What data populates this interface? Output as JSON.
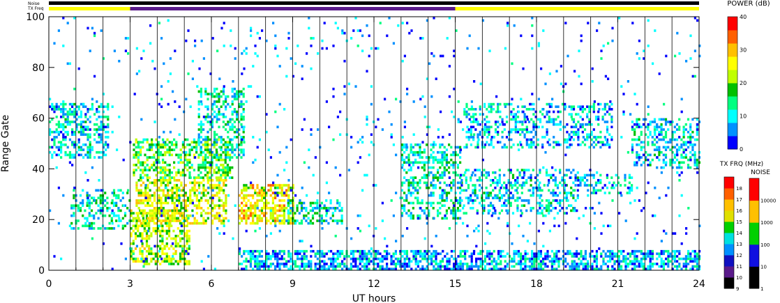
{
  "chart_data": {
    "type": "heatmap",
    "xlabel": "UT hours",
    "ylabel": "Range Gate",
    "xlim": [
      0,
      24
    ],
    "ylim": [
      0,
      100
    ],
    "x_ticks": [
      0,
      3,
      6,
      9,
      12,
      15,
      18,
      21,
      24
    ],
    "y_ticks": [
      0,
      20,
      40,
      60,
      80,
      100
    ],
    "x_tick_labels": [
      "0",
      "3",
      "6",
      "9",
      "12",
      "15",
      "18",
      "21",
      "24"
    ],
    "y_tick_labels": [
      "0",
      "20",
      "40",
      "60",
      "80",
      "100"
    ],
    "scan_boundaries_hours": [
      1,
      2,
      3,
      4,
      5,
      6,
      7,
      8,
      9,
      10,
      11,
      12,
      13,
      14,
      15,
      16,
      17,
      18,
      19,
      20,
      21,
      22,
      23,
      24
    ],
    "top_bars": {
      "noise_label": "Noise",
      "txfreq_label": "TX Freq",
      "noise_color": "#000000",
      "txfreq_segments": [
        {
          "start": 0,
          "end": 3,
          "color": "#ffff00"
        },
        {
          "start": 3,
          "end": 15,
          "color": "#5a1a8a"
        },
        {
          "start": 15,
          "end": 24,
          "color": "#ffff00"
        }
      ]
    },
    "power_colorbar": {
      "title": "POWER (dB)",
      "min": 0,
      "max": 40,
      "tick_labels": [
        "0",
        "10",
        "20",
        "30",
        "40"
      ],
      "colors": [
        "#0000ff",
        "#0090ff",
        "#00ffff",
        "#00ff80",
        "#00c000",
        "#c0ff00",
        "#ffff00",
        "#ffc000",
        "#ff6000",
        "#ff0000"
      ]
    },
    "txfreq_colorbar": {
      "title": "TX FRQ (MHz)",
      "tick_labels": [
        "9",
        "10",
        "11",
        "12",
        "13",
        "14",
        "15",
        "16",
        "17",
        "18"
      ],
      "colors": [
        "#000000",
        "#5a1a8a",
        "#1010c0",
        "#0090ff",
        "#00e0e0",
        "#00d000",
        "#e0e000",
        "#ffc000",
        "#ff6000",
        "#ff0000"
      ]
    },
    "noise_colorbar": {
      "title": "NOISE",
      "tick_labels": [
        "1",
        "10",
        "100",
        "1000",
        "10000"
      ],
      "colors": [
        "#000000",
        "#1010e0",
        "#00d000",
        "#ffc000",
        "#ff0000"
      ]
    },
    "echo_regions": [
      {
        "t0": 0.0,
        "t1": 2.2,
        "g0": 44,
        "g1": 66,
        "density": 0.45,
        "level": 10
      },
      {
        "t0": 0.8,
        "t1": 3.0,
        "g0": 16,
        "g1": 32,
        "density": 0.35,
        "level": 12
      },
      {
        "t0": 3.0,
        "t1": 5.2,
        "g0": 2,
        "g1": 24,
        "density": 0.5,
        "level": 22
      },
      {
        "t0": 3.2,
        "t1": 6.5,
        "g0": 18,
        "g1": 36,
        "density": 0.55,
        "level": 24
      },
      {
        "t0": 3.1,
        "t1": 6.8,
        "g0": 36,
        "g1": 52,
        "density": 0.5,
        "level": 18
      },
      {
        "t0": 5.5,
        "t1": 7.2,
        "g0": 44,
        "g1": 72,
        "density": 0.4,
        "level": 12
      },
      {
        "t0": 7.0,
        "t1": 9.0,
        "g0": 18,
        "g1": 34,
        "density": 0.6,
        "level": 26
      },
      {
        "t0": 8.8,
        "t1": 10.8,
        "g0": 18,
        "g1": 28,
        "density": 0.4,
        "level": 12
      },
      {
        "t0": 7.0,
        "t1": 24.0,
        "g0": 0,
        "g1": 8,
        "density": 0.6,
        "level": 8
      },
      {
        "t0": 13.0,
        "t1": 15.2,
        "g0": 20,
        "g1": 50,
        "density": 0.4,
        "level": 12
      },
      {
        "t0": 15.2,
        "t1": 19.5,
        "g0": 22,
        "g1": 40,
        "density": 0.35,
        "level": 10
      },
      {
        "t0": 15.3,
        "t1": 20.8,
        "g0": 48,
        "g1": 66,
        "density": 0.35,
        "level": 9
      },
      {
        "t0": 19.5,
        "t1": 21.5,
        "g0": 30,
        "g1": 38,
        "density": 0.35,
        "level": 9
      },
      {
        "t0": 21.5,
        "t1": 24.0,
        "g0": 40,
        "g1": 60,
        "density": 0.4,
        "level": 10
      },
      {
        "t0": 0.0,
        "t1": 24.0,
        "g0": 0,
        "g1": 100,
        "density": 0.025,
        "level": 6
      }
    ]
  }
}
